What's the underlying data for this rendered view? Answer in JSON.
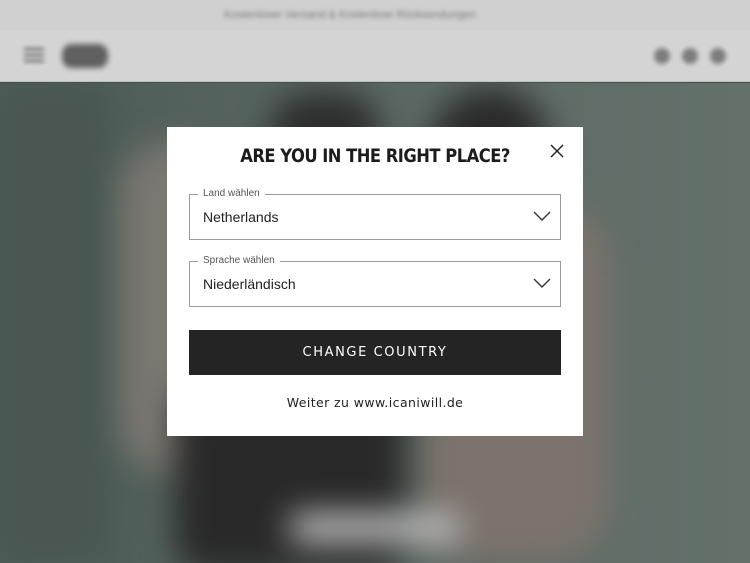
{
  "background": {
    "promo_text": "Kostenloser Versand & Kostenlose Rücksendungen",
    "icons": [
      "menu-icon",
      "search-icon",
      "account-icon",
      "cart-icon"
    ]
  },
  "modal": {
    "title": "ARE YOU IN THE RIGHT PLACE?",
    "close_icon": "close-icon",
    "country_field": {
      "label": "Land wählen",
      "value": "Netherlands"
    },
    "language_field": {
      "label": "Sprache wählen",
      "value": "Niederländisch"
    },
    "change_button_label": "CHANGE COUNTRY",
    "continue_link": "Weiter zu www.icaniwill.de"
  },
  "colors": {
    "button_bg": "#242424",
    "field_border": "#9a9a9a",
    "modal_bg": "#ffffff"
  }
}
